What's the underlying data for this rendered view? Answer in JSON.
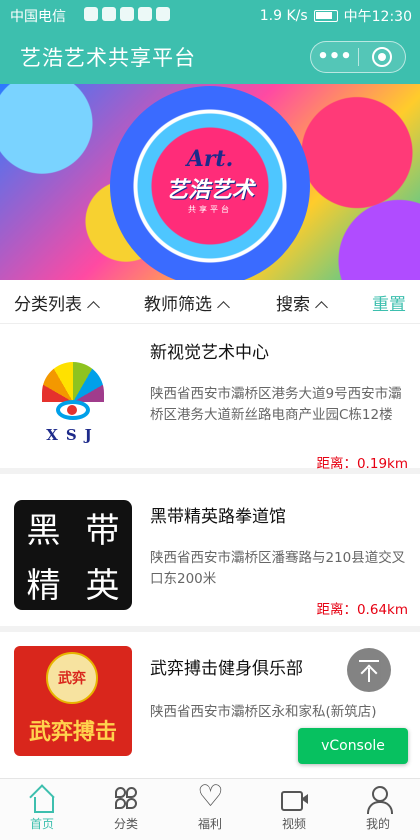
{
  "status_bar": {
    "carrier": "中国电信",
    "speed": "1.9 K/s",
    "time": "中午12:30"
  },
  "nav": {
    "title": "艺浩艺术共享平台",
    "more_label": "•••"
  },
  "banner": {
    "logo_art": "Art.",
    "logo_brand": "艺浩艺术",
    "logo_sub": "共享平台"
  },
  "filters": {
    "category": "分类列表",
    "teacher": "教师筛选",
    "search": "搜索",
    "reset": "重置"
  },
  "items": [
    {
      "name": "新视觉艺术中心",
      "address": "陕西省西安市灞桥区港务大道9号西安市灞桥区港务大道新丝路电商产业园C栋12楼",
      "distance": "距离：0.19km",
      "logo_text": "XSJ"
    },
    {
      "name": "黑带精英路拳道馆",
      "address": "陕西省西安市灞桥区潘骞路与210县道交叉口东200米",
      "distance": "距离：0.64km",
      "logo_chars": [
        "黑",
        "带",
        "精",
        "英"
      ]
    },
    {
      "name": "武弈搏击健身俱乐部",
      "address": "陕西省西安市灞桥区永和家私(新筑店)",
      "logo_badge": "武弈",
      "logo_text": "武弈搏击"
    }
  ],
  "vconsole": "vConsole",
  "tabs": [
    {
      "label": "首页",
      "icon": "home-icon"
    },
    {
      "label": "分类",
      "icon": "category-icon"
    },
    {
      "label": "福利",
      "icon": "heart-icon"
    },
    {
      "label": "视频",
      "icon": "video-icon"
    },
    {
      "label": "我的",
      "icon": "user-icon"
    }
  ],
  "colors": {
    "primary": "#3dbfae",
    "distance": "#e60012",
    "vconsole": "#07c160"
  }
}
